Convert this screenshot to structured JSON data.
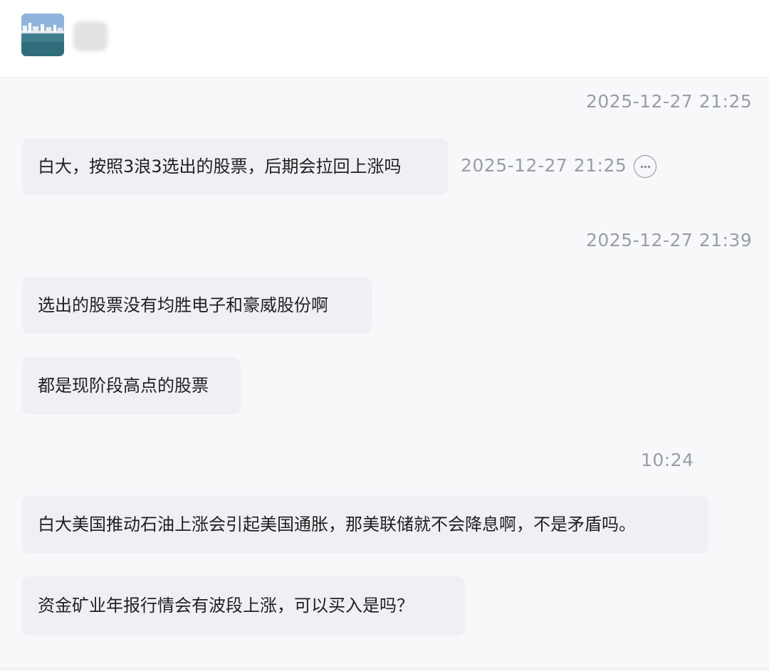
{
  "header": {
    "avatar_icon": "landscape-avatar-icon",
    "name_blurred": true
  },
  "messages": [
    {
      "timestamp": "2025-12-27 21:25"
    },
    {
      "text": "白大，按照3浪3选出的股票，后期会拉回上涨吗",
      "inline_time": "2025-12-27 21:25",
      "more_icon": "more-options-icon"
    },
    {
      "timestamp": "2025-12-27 21:39"
    },
    {
      "text": "选出的股票没有均胜电子和豪威股份啊"
    },
    {
      "text": "都是现阶段高点的股票"
    },
    {
      "timestamp": "10:24"
    },
    {
      "text": "白大美国推动石油上涨会引起美国通胀，那美联储就不会降息啊，不是矛盾吗。"
    },
    {
      "text": "资金矿业年报行情会有波段上涨，可以买入是吗？"
    }
  ],
  "colors": {
    "background": "#f7f8fa",
    "bubble": "#eef0f4",
    "timestamp": "#9a9da3"
  }
}
